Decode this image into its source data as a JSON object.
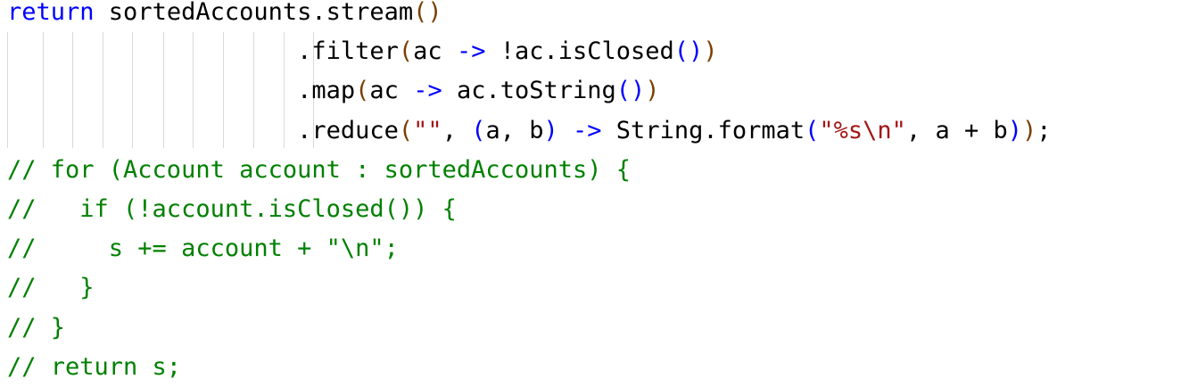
{
  "editor": {
    "language": "java",
    "colors": {
      "keyword": "#0000ff",
      "plain": "#000000",
      "paren_outer": "#7a3e00",
      "paren_inner": "#0000ff",
      "string": "#a31515",
      "comment": "#008000",
      "indent_guide": "#d9d9d9"
    },
    "lines": [
      {
        "tokens": [
          {
            "text": "return",
            "type": "keyword"
          },
          {
            "text": " sortedAccounts.stream",
            "type": "plain"
          },
          {
            "text": "()",
            "type": "paren_outer"
          }
        ]
      },
      {
        "tokens": [
          {
            "text": "                    .filter",
            "type": "plain"
          },
          {
            "text": "(",
            "type": "paren_outer"
          },
          {
            "text": "ac ",
            "type": "plain"
          },
          {
            "text": "->",
            "type": "paren_inner"
          },
          {
            "text": " !ac.isClosed",
            "type": "plain"
          },
          {
            "text": "()",
            "type": "paren_inner"
          },
          {
            "text": ")",
            "type": "paren_outer"
          }
        ]
      },
      {
        "tokens": [
          {
            "text": "                    .map",
            "type": "plain"
          },
          {
            "text": "(",
            "type": "paren_outer"
          },
          {
            "text": "ac ",
            "type": "plain"
          },
          {
            "text": "->",
            "type": "paren_inner"
          },
          {
            "text": " ac.toString",
            "type": "plain"
          },
          {
            "text": "()",
            "type": "paren_inner"
          },
          {
            "text": ")",
            "type": "paren_outer"
          }
        ]
      },
      {
        "tokens": [
          {
            "text": "                    .reduce",
            "type": "plain"
          },
          {
            "text": "(",
            "type": "paren_outer"
          },
          {
            "text": "\"\"",
            "type": "string"
          },
          {
            "text": ", ",
            "type": "plain"
          },
          {
            "text": "(",
            "type": "paren_inner"
          },
          {
            "text": "a, b",
            "type": "plain"
          },
          {
            "text": ")",
            "type": "paren_inner"
          },
          {
            "text": " ",
            "type": "plain"
          },
          {
            "text": "->",
            "type": "paren_inner"
          },
          {
            "text": " String.format",
            "type": "plain"
          },
          {
            "text": "(",
            "type": "paren_inner"
          },
          {
            "text": "\"%s\\n\"",
            "type": "string"
          },
          {
            "text": ", a + b",
            "type": "plain"
          },
          {
            "text": ")",
            "type": "paren_inner"
          },
          {
            "text": ")",
            "type": "paren_outer"
          },
          {
            "text": ";",
            "type": "plain"
          }
        ]
      },
      {
        "tokens": [
          {
            "text": "// for (Account account : sortedAccounts) {",
            "type": "comment"
          }
        ]
      },
      {
        "tokens": [
          {
            "text": "//   if (!account.isClosed()) {",
            "type": "comment"
          }
        ]
      },
      {
        "tokens": [
          {
            "text": "//     s += account + \"\\n\";",
            "type": "comment"
          }
        ]
      },
      {
        "tokens": [
          {
            "text": "//   }",
            "type": "comment"
          }
        ]
      },
      {
        "tokens": [
          {
            "text": "// }",
            "type": "comment"
          }
        ]
      },
      {
        "tokens": [
          {
            "text": "// return s;",
            "type": "comment"
          }
        ]
      }
    ]
  }
}
